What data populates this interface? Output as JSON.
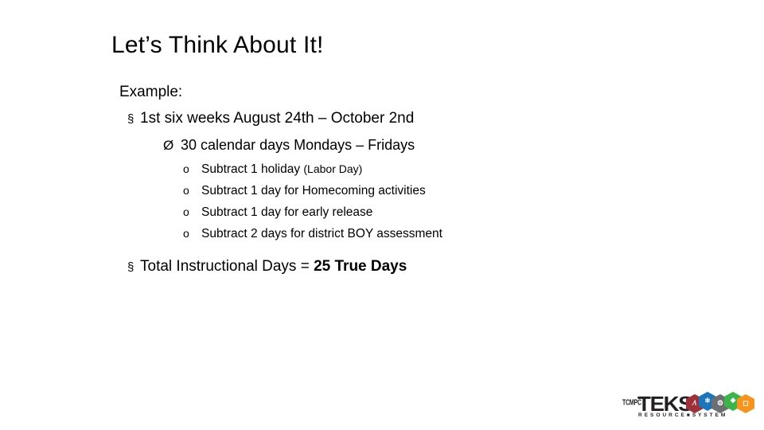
{
  "slide": {
    "title": "Let’s Think About It!",
    "lines": {
      "example_label": "Example:",
      "six_weeks": {
        "bullet": "§",
        "text": "1st six weeks August 24th – October 2nd"
      },
      "calendar_days": {
        "bullet": "Ø",
        "text": "30 calendar days Mondays – Fridays"
      },
      "subtract_items": [
        {
          "bullet": "o",
          "text": "Subtract 1 holiday ",
          "text_small": "(Labor Day)"
        },
        {
          "bullet": "o",
          "text": "Subtract 1 day for Homecoming activities",
          "text_small": ""
        },
        {
          "bullet": "o",
          "text": "Subtract 1 day for early release",
          "text_small": ""
        },
        {
          "bullet": "o",
          "text": "Subtract 2 days for district BOY assessment",
          "text_small": ""
        }
      ],
      "total": {
        "bullet": "§",
        "text_plain": "Total Instructional Days = ",
        "text_bold": "25 True Days"
      }
    }
  },
  "logo": {
    "tcmpc": "TCMPC",
    "teks": "TEKS",
    "subtitle": "R E S O U R C E ■ S Y S T E M",
    "hexes": [
      {
        "color": "#9e3039",
        "glyph": "∕\\"
      },
      {
        "color": "#1b75bb",
        "glyph": "⚛"
      },
      {
        "color": "#6d6e71",
        "glyph": "⚙"
      },
      {
        "color": "#39b54a",
        "glyph": "❖"
      },
      {
        "color": "#f7941e",
        "glyph": "◻"
      }
    ]
  }
}
